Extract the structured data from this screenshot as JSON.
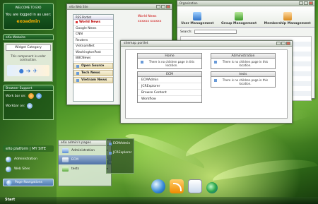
{
  "welcome": {
    "title": "WELCOME TO EXO",
    "line": "You are logged in as user:",
    "user": "exoadmin"
  },
  "gadget": {
    "title": "eXo Website",
    "category": "Widget Category",
    "message": "This component is under contruction."
  },
  "workspace": {
    "title": "Browser Support",
    "work_label": "Work bar on:",
    "workbar_label": "Workbar on:"
  },
  "nav": {
    "title": "eXo platform | MY SITE",
    "items": [
      "Administration",
      "Web Sites",
      "Page Navigations"
    ]
  },
  "start_label": "Start",
  "news_window": {
    "title": "eXo Web Site",
    "list_header": "RSS Portlet",
    "items": [
      "World News",
      "Google News",
      "CNN",
      "Reuters",
      "VietnamNet",
      "WashingtonPost",
      "BBCNews"
    ],
    "categories": [
      "Open Source",
      "Tech News",
      "Vietnam News"
    ],
    "headline": "World News",
    "subline": "xxxxxx xxxxxx"
  },
  "org_window": {
    "title": "Organization",
    "tools": [
      "User Management",
      "Group Management",
      "Membership Management"
    ],
    "search_label": "Search:"
  },
  "sitemap_window": {
    "tab": "sitemap portlet",
    "nodes": {
      "home": {
        "title": "Home",
        "text": "There is no children page in this location."
      },
      "admin": {
        "title": "Administration",
        "text": "There is no children page in this location."
      },
      "ecm": {
        "title": "ECM",
        "items": [
          "ECMAdmin",
          "JCRExplorer",
          "Browse Content",
          "Workflow"
        ]
      },
      "tests": {
        "title": "tests",
        "text": "There is no children page in this location."
      }
    }
  },
  "startmenu": {
    "header": "eXo admin's pages",
    "items": [
      "Administration",
      "ECM",
      "tests"
    ],
    "submenu": [
      "ECMAdmin",
      "JCRExplorer",
      "..."
    ]
  },
  "colors": {
    "accent_orange": "#ffb000",
    "headline_red": "#cc0000",
    "menu_highlight": "#4f72a6"
  },
  "dock_icons": [
    "globe-icon",
    "rss-icon",
    "network-icon",
    "earth-icon"
  ]
}
